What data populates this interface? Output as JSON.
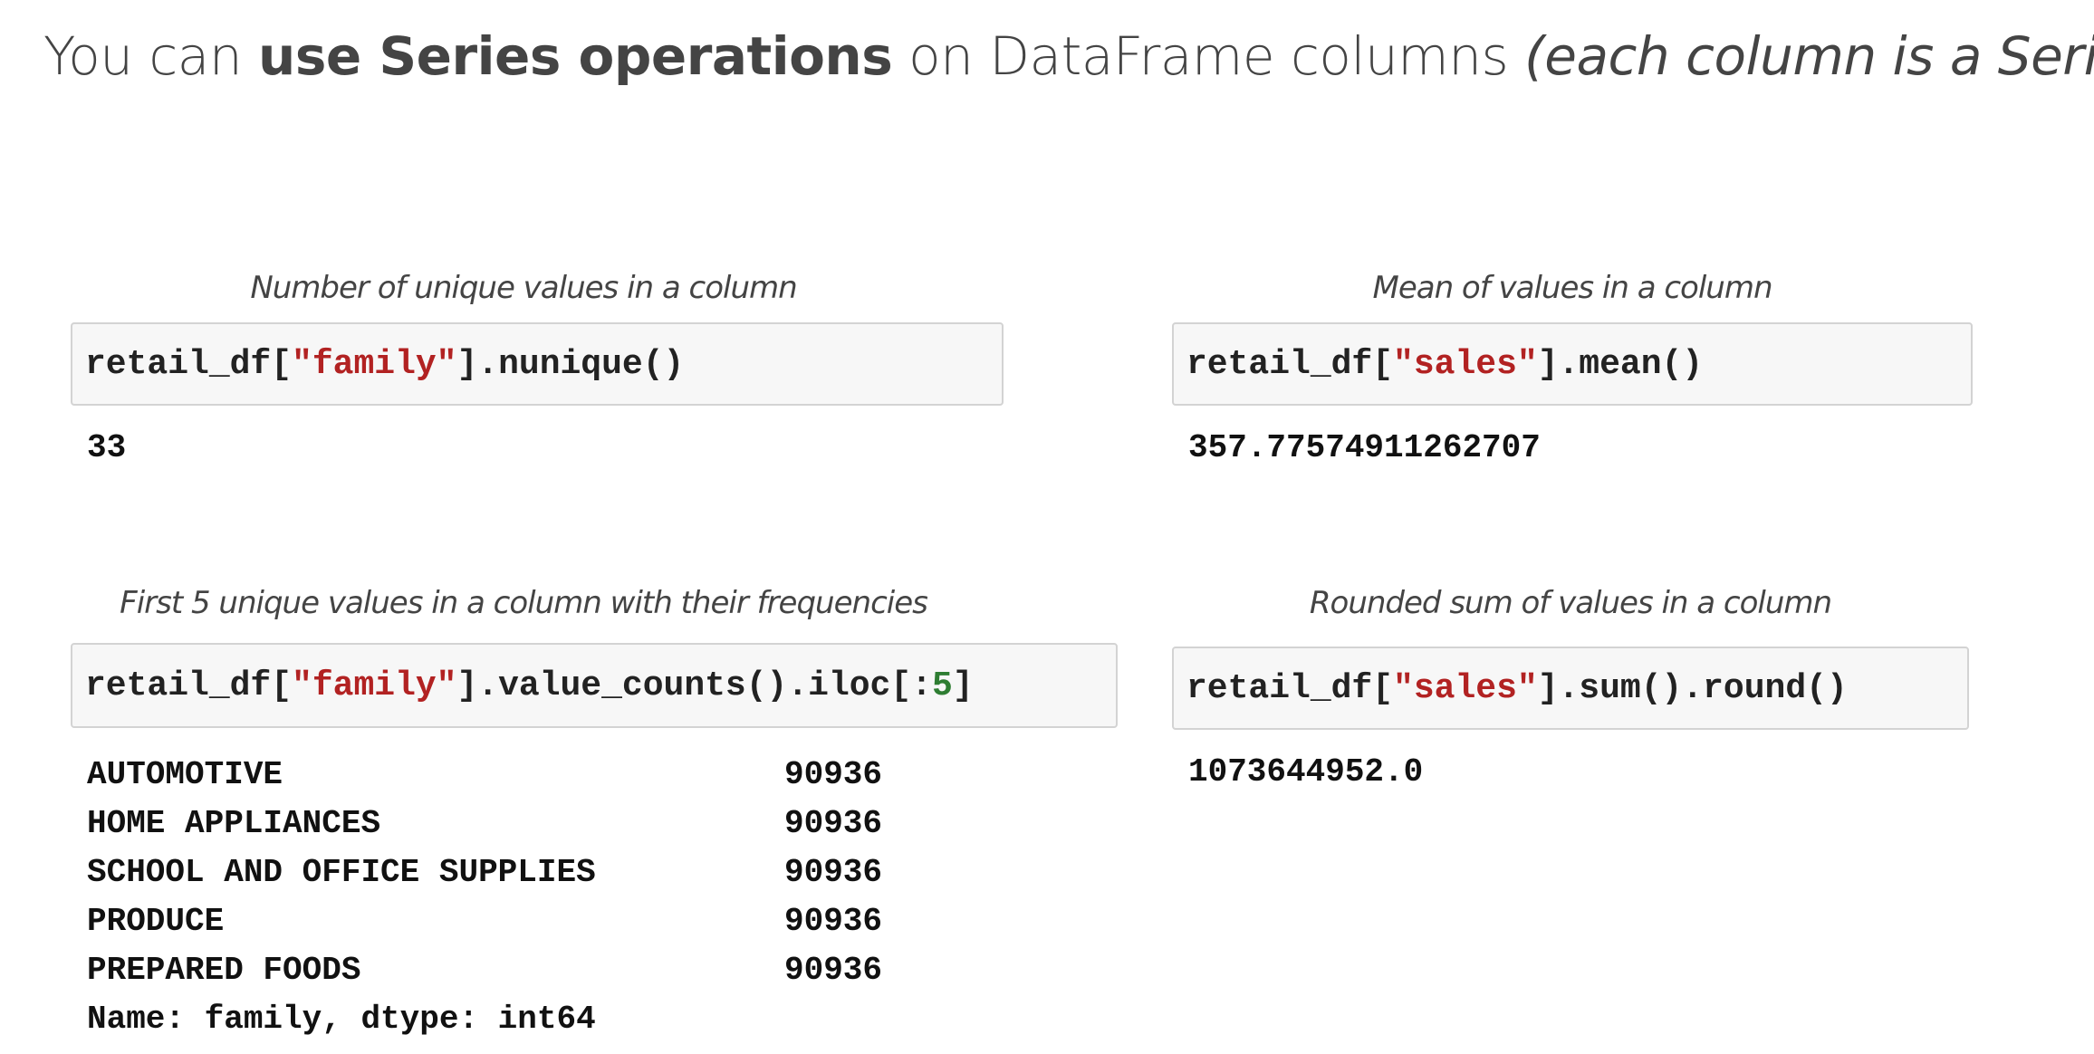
{
  "title": {
    "prefix": "You can ",
    "bold": "use Series operations",
    "middle": " on DataFrame columns ",
    "italic": "(each column is a Series!)"
  },
  "examples": [
    {
      "caption": "Number of unique values in a column",
      "code": {
        "obj": "retail_df[",
        "str": "\"family\"",
        "rest": "].nunique()"
      },
      "output": "33"
    },
    {
      "caption": "Mean of values in a column",
      "code": {
        "obj": "retail_df[",
        "str": "\"sales\"",
        "rest": "].mean()"
      },
      "output": "357.77574911262707"
    },
    {
      "caption": "First 5 unique values in a column with their frequencies",
      "code": {
        "obj": "retail_df[",
        "str": "\"family\"",
        "rest": "].value_counts().iloc[:",
        "num": "5",
        "end": "]"
      },
      "output_rows": [
        {
          "key": "AUTOMOTIVE",
          "value": "90936"
        },
        {
          "key": "HOME APPLIANCES",
          "value": "90936"
        },
        {
          "key": "SCHOOL AND OFFICE SUPPLIES",
          "value": "90936"
        },
        {
          "key": "PRODUCE",
          "value": "90936"
        },
        {
          "key": "PREPARED FOODS",
          "value": "90936"
        }
      ],
      "output_footer": "Name: family, dtype: int64"
    },
    {
      "caption": "Rounded sum of values in a column",
      "code": {
        "obj": "retail_df[",
        "str": "\"sales\"",
        "rest": "].sum().round()"
      },
      "output": "1073644952.0"
    }
  ],
  "colors": {
    "string": "#b22222",
    "number": "#2e7d32",
    "code_bg": "#f7f7f7",
    "text": "#444444"
  }
}
